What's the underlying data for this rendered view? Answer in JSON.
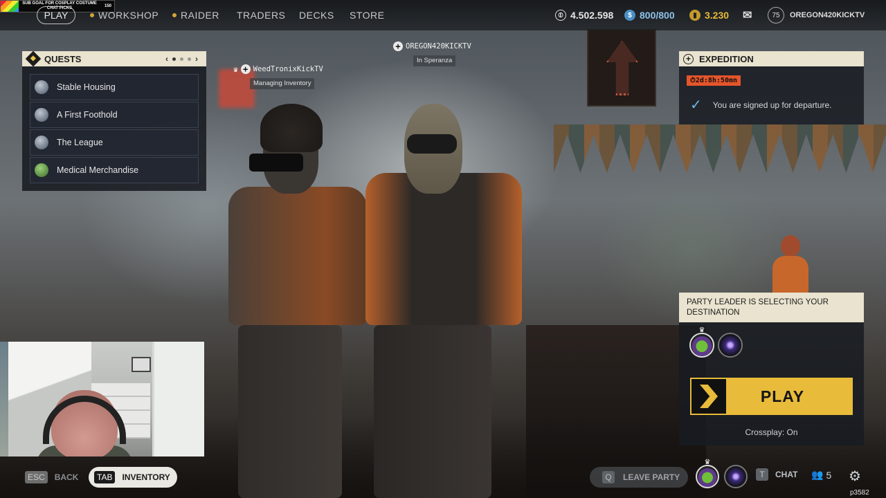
{
  "stream_overlay": {
    "goal_text": "SUB GOAL FOR COSPLAY COSTUME CHAT PICKS",
    "goal_count": "150"
  },
  "nav": {
    "play": "PLAY",
    "items": [
      {
        "label": "WORKSHOP",
        "has_dot": true
      },
      {
        "label": "RAIDER",
        "has_dot": true
      },
      {
        "label": "TRADERS",
        "has_dot": false
      },
      {
        "label": "DECKS",
        "has_dot": false
      },
      {
        "label": "STORE",
        "has_dot": false
      }
    ]
  },
  "currency": {
    "coins": "4.502.598",
    "tokens": "800/800",
    "premium": "3.230",
    "level": "75",
    "username": "OREGON420KICKTV"
  },
  "quests": {
    "title": "QUESTS",
    "page": 1,
    "pages": 3,
    "items": [
      {
        "label": "Stable Housing"
      },
      {
        "label": "A First Foothold"
      },
      {
        "label": "The League"
      },
      {
        "label": "Medical Merchandise"
      }
    ]
  },
  "players": [
    {
      "name": "OREGON420KICKTV",
      "status": "In Speranza",
      "leader": false
    },
    {
      "name": "WeedTronixKickTV",
      "status": "Managing Inventory",
      "leader": true
    }
  ],
  "expedition": {
    "title": "EXPEDITION",
    "timer": "2d:8h:50mn",
    "message": "You are signed up for departure."
  },
  "party": {
    "status": "PARTY LEADER IS SELECTING YOUR DESTINATION",
    "play_label": "PLAY",
    "crossplay": "Crossplay: On"
  },
  "bottom": {
    "back_key": "ESC",
    "back_label": "BACK",
    "inventory_key": "TAB",
    "inventory_label": "INVENTORY",
    "leave_key": "Q",
    "leave_label": "LEAVE PARTY",
    "chat_key": "T",
    "chat_label": "CHAT",
    "friends_count": "5",
    "build": "p3582"
  },
  "colors": {
    "accent_yellow": "#e8bb3a",
    "panel_header": "#e9e3cf",
    "timer_bg": "#e5552b"
  }
}
